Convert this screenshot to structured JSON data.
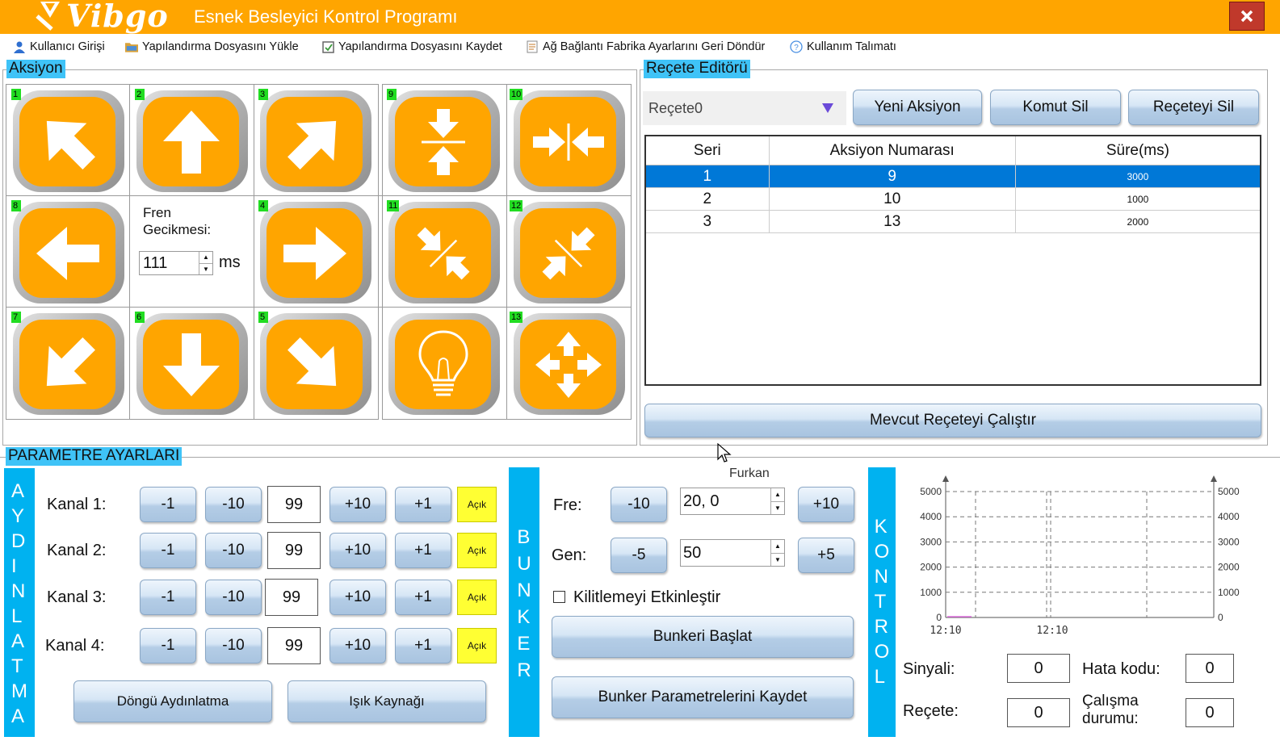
{
  "window": {
    "logo": "Vibgo",
    "title": "Esnek Besleyici Kontrol Programı",
    "colors": {
      "accent": "#ffa500",
      "group_title": "#3fc3f7",
      "vertical_bar": "#00b2f0",
      "selection": "#0078d7",
      "close": "#c0392b"
    }
  },
  "menu": [
    {
      "label": "Kullanıcı Girişi",
      "icon": "user-icon"
    },
    {
      "label": "Yapılandırma Dosyasını Yükle",
      "icon": "folder-icon"
    },
    {
      "label": "Yapılandırma Dosyasını Kaydet",
      "icon": "save-icon"
    },
    {
      "label": "Ağ Bağlantı Fabrika Ayarlarını Geri Döndür",
      "icon": "document-icon"
    },
    {
      "label": "Kullanım Talımatı",
      "icon": "help-icon"
    }
  ],
  "aksiyon": {
    "title": "Aksiyon",
    "buttons": [
      {
        "num": "1",
        "icon": "arrow-up-left-icon"
      },
      {
        "num": "2",
        "icon": "arrow-up-icon"
      },
      {
        "num": "3",
        "icon": "arrow-up-right-icon"
      },
      {
        "num": "8",
        "icon": "arrow-left-icon"
      },
      {
        "num": "4",
        "icon": "arrow-right-icon"
      },
      {
        "num": "7",
        "icon": "arrow-down-left-icon"
      },
      {
        "num": "6",
        "icon": "arrow-down-icon"
      },
      {
        "num": "5",
        "icon": "arrow-down-right-icon"
      },
      {
        "num": "9",
        "icon": "vertical-converge-icon"
      },
      {
        "num": "10",
        "icon": "horizontal-converge-icon"
      },
      {
        "num": "11",
        "icon": "diagonal-converge-icon"
      },
      {
        "num": "12",
        "icon": "diagonal-converge-alt-icon"
      },
      {
        "num": "",
        "icon": "light-bulb-icon"
      },
      {
        "num": "13",
        "icon": "expand-all-icon"
      }
    ],
    "brake_label_1": "Fren",
    "brake_label_2": "Gecikmesi:",
    "brake_value": "111",
    "brake_unit": "ms"
  },
  "recipe_editor": {
    "title": "Reçete Editörü",
    "selected_recipe": "Reçete0",
    "new_action": "Yeni Aksiyon",
    "delete_command": "Komut Sil",
    "delete_recipe": "Reçeteyi Sil",
    "columns": [
      "Seri",
      "Aksiyon Numarası",
      "Süre(ms)"
    ],
    "rows": [
      {
        "seri": "1",
        "aksiyon": "9",
        "sure": "3000",
        "selected": true
      },
      {
        "seri": "2",
        "aksiyon": "10",
        "sure": "1000",
        "selected": false
      },
      {
        "seri": "3",
        "aksiyon": "13",
        "sure": "2000",
        "selected": false
      }
    ],
    "run_button": "Mevcut Reçeteyi Çalıştır"
  },
  "parametre": {
    "title": "PARAMETRE AYARLARI",
    "aydinlatma_letters": [
      "A",
      "Y",
      "D",
      "I",
      "N",
      "L",
      "A",
      "T",
      "M",
      "A"
    ],
    "channels": [
      {
        "label": "Kanal 1:",
        "value": "99",
        "state": "Açık"
      },
      {
        "label": "Kanal 2:",
        "value": "99",
        "state": "Açık"
      },
      {
        "label": "Kanal 3:",
        "value": "99",
        "state": "Açık"
      },
      {
        "label": "Kanal 4:",
        "value": "99",
        "state": "Açık"
      }
    ],
    "step_labels": {
      "m1": "-1",
      "m10": "-10",
      "p10": "+10",
      "p1": "+1"
    },
    "cycle_button": "Döngü Aydınlatma",
    "light_source_button": "Işık Kaynağı"
  },
  "bunker": {
    "letters": [
      "B",
      "U",
      "N",
      "K",
      "E",
      "R"
    ],
    "overlay_text": "Furkan",
    "fre_label": "Fre:",
    "fre_minus": "-10",
    "fre_value": "20, 0",
    "fre_plus": "+10",
    "gen_label": "Gen:",
    "gen_minus": "-5",
    "gen_value": "50",
    "gen_plus": "+5",
    "lock_label": "Kilitlemeyi Etkinleştir",
    "start_button": "Bunkeri Başlat",
    "save_button": "Bunker Parametrelerini Kaydet"
  },
  "kontrol": {
    "letters": [
      "K",
      "O",
      "N",
      "T",
      "R",
      "O",
      "L"
    ],
    "signal_label": "Sinyali:",
    "signal_value": "0",
    "error_label": "Hata kodu:",
    "error_value": "0",
    "recipe_label": "Reçete:",
    "recipe_value": "0",
    "status_label_1": "Çalışma",
    "status_label_2": "durumu:",
    "status_value": "0"
  },
  "chart_data": {
    "type": "line",
    "y_ticks_left": [
      "5000",
      "4000",
      "3000",
      "2000",
      "1000",
      "0"
    ],
    "y_ticks_right": [
      "5000",
      "4000",
      "3000",
      "2000",
      "1000",
      "0"
    ],
    "x_ticks": [
      "12:10",
      "12:10"
    ],
    "ylim": [
      0,
      5000
    ],
    "grid": true,
    "series": []
  }
}
